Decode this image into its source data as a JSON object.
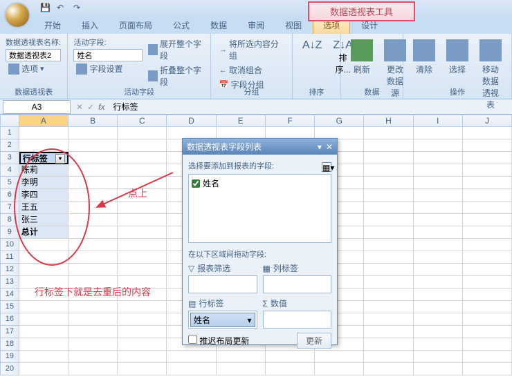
{
  "context_tab": "数据透视表工具",
  "tabs": [
    "开始",
    "插入",
    "页面布局",
    "公式",
    "数据",
    "审阅",
    "视图",
    "选项",
    "设计"
  ],
  "active_tab_index": 7,
  "ribbon": {
    "g1": {
      "label": "数据透视表",
      "name_label": "数据透视表名称:",
      "name_value": "数据透视表2",
      "options": "选项"
    },
    "g2": {
      "label": "活动字段",
      "field_label": "活动字段:",
      "field_value": "姓名",
      "settings": "字段设置",
      "expand": "展开整个字段",
      "collapse": "折叠整个字段"
    },
    "g3": {
      "label": "分组",
      "group_sel": "将所选内容分组",
      "ungroup": "取消组合",
      "group_field": "字段分组"
    },
    "g4": {
      "label": "排序",
      "sort": "排序..."
    },
    "g5": {
      "label": "数据",
      "refresh": "刷新",
      "change_source": "更改数据源"
    },
    "g6": {
      "label": "操作",
      "clear": "清除",
      "select": "选择",
      "move": "移动数据透视表"
    }
  },
  "namebox": "A3",
  "formula": "行标签",
  "columns": [
    "A",
    "B",
    "C",
    "D",
    "E",
    "F",
    "G",
    "H",
    "I",
    "J"
  ],
  "rows_data": [
    "行标签",
    "陈莉",
    "李明",
    "李四",
    "王五",
    "张三",
    "总计"
  ],
  "annotation_click": "点上",
  "annotation_result": "行标签下就是去重后的内容",
  "fieldlist": {
    "title": "数据透视表字段列表",
    "choose_label": "选择要添加到报表的字段:",
    "field_name": "姓名",
    "areas_label": "在以下区域间拖动字段:",
    "report_filter": "报表筛选",
    "col_labels": "列标签",
    "row_labels": "行标签",
    "values": "数值",
    "row_item": "姓名",
    "defer": "推迟布局更新",
    "update": "更新"
  }
}
